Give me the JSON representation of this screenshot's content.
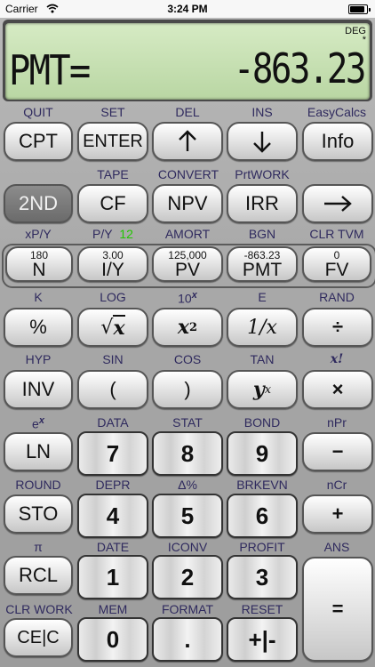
{
  "status": {
    "carrier": "Carrier",
    "time": "3:24 PM"
  },
  "display": {
    "mode": "DEG",
    "indicator": "*",
    "label": "PMT=",
    "value": "-863.23"
  },
  "row1_labels": [
    "QUIT",
    "SET",
    "DEL",
    "INS",
    "EasyCalcs"
  ],
  "row1_keys": [
    "CPT",
    "ENTER",
    "",
    "",
    "Info"
  ],
  "row2_labels": [
    "TAPE",
    "CONVERT",
    "PrtWORK"
  ],
  "row2_keys": [
    "2ND",
    "CF",
    "NPV",
    "IRR",
    ""
  ],
  "row3_labels": [
    "xP/Y",
    "P/Y",
    "AMORT",
    "BGN",
    "CLR TVM"
  ],
  "py_value": "12",
  "tvm": [
    {
      "top": "180",
      "key": "N"
    },
    {
      "top": "3.00",
      "key": "I/Y"
    },
    {
      "top": "125,000",
      "key": "PV"
    },
    {
      "top": "-863.23",
      "key": "PMT"
    },
    {
      "top": "0",
      "key": "FV"
    }
  ],
  "row4_labels": [
    "K",
    "LOG",
    "10",
    "E",
    "RAND"
  ],
  "row4_keys": [
    "%",
    "x",
    "x",
    "1/x",
    "÷"
  ],
  "row5_labels": [
    "HYP",
    "SIN",
    "COS",
    "TAN",
    "x!"
  ],
  "row5_keys": [
    "INV",
    "(",
    ")",
    "y",
    "×"
  ],
  "row6_labels": [
    "e",
    "DATA",
    "STAT",
    "BOND",
    "nPr"
  ],
  "row6_keys": [
    "LN",
    "7",
    "8",
    "9",
    "−"
  ],
  "row7_labels": [
    "ROUND",
    "DEPR",
    "Δ%",
    "BRKEVN",
    "nCr"
  ],
  "row7_keys": [
    "STO",
    "4",
    "5",
    "6",
    "+"
  ],
  "row8_labels": [
    "π",
    "DATE",
    "ICONV",
    "PROFIT",
    "ANS"
  ],
  "row8_keys": [
    "RCL",
    "1",
    "2",
    "3",
    "="
  ],
  "row9_labels": [
    "CLR WORK",
    "MEM",
    "FORMAT",
    "RESET"
  ],
  "row9_keys": [
    "CE|C",
    "0",
    ".",
    "+|-"
  ]
}
